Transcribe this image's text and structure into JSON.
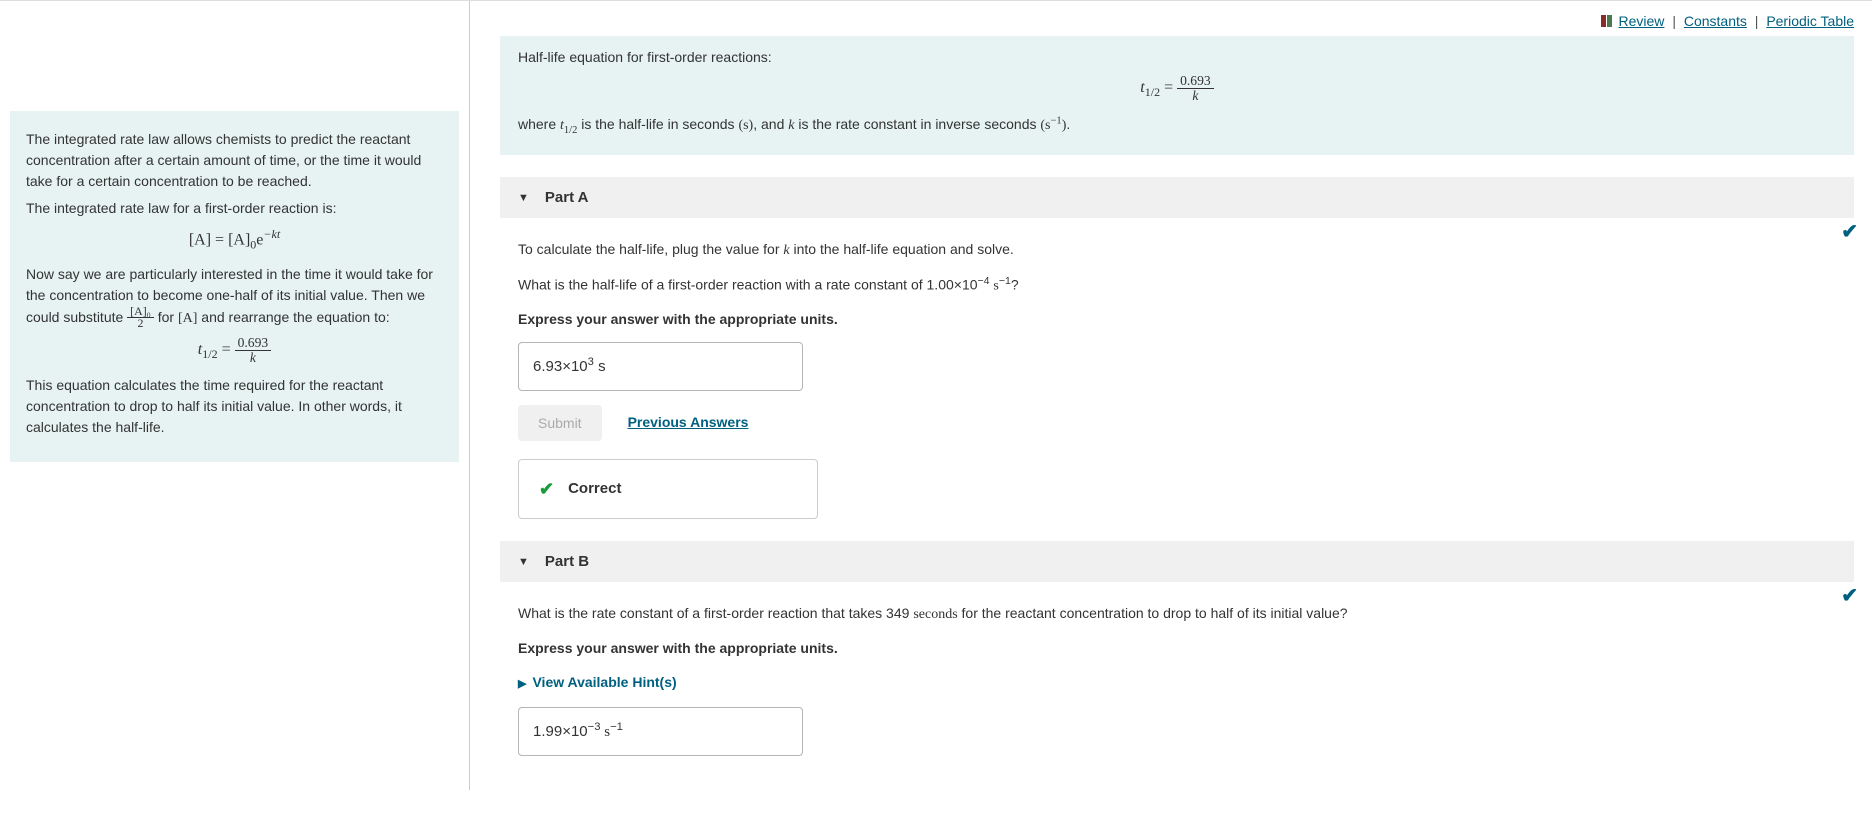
{
  "topLinks": {
    "review": "Review",
    "constants": "Constants",
    "periodic": "Periodic Table",
    "sep": "|"
  },
  "intro": {
    "p1": "The integrated rate law allows chemists to predict the reactant concentration after a certain amount of time, or the time it would take for a certain concentration to be reached.",
    "p2": "The integrated rate law for a first-order reaction is:",
    "eq1_lhs": "[A] = [A]",
    "eq1_sub": "0",
    "eq1_e": "e",
    "eq1_exp": "−kt",
    "p3a": "Now say we are particularly interested in the time it would take for the concentration to become one-half of its initial value. Then we could substitute ",
    "frac1_num": "[A]₀",
    "frac1_den": "2",
    "p3b": " for ",
    "p3c": "[A]",
    "p3d": " and rearrange the equation to:",
    "eq2_lhs": "t",
    "eq2_sub": "1/2",
    "eq2_eq": " = ",
    "eq2_num": "0.693",
    "eq2_den": "k",
    "p4": "This equation calculates the time required for the reactant concentration to drop to half its initial value. In other words, it calculates the half-life."
  },
  "infoBox": {
    "line1": "Half-life equation for first-order reactions:",
    "eq_lhs": "t",
    "eq_sub": "1/2",
    "eq_eq": " = ",
    "eq_num": "0.693",
    "eq_den": "k",
    "line2a": "where ",
    "line2b": "t",
    "line2b_sub": "1/2",
    "line2c": " is the half-life in seconds ",
    "line2d": "(s)",
    "line2e": ", and ",
    "line2f": "k",
    "line2g": " is the rate constant in inverse seconds ",
    "line2h": "(s",
    "line2h_sup": "−1",
    "line2i": ")",
    "line2j": "."
  },
  "partA": {
    "title": "Part A",
    "p1a": "To calculate the half-life, plug the value for ",
    "p1b": "k",
    "p1c": " into the half-life equation and solve.",
    "p2a": "What is the half-life of a first-order reaction with a rate constant of 1.00×10",
    "p2a_sup": "−4",
    "p2b": " s",
    "p2b_sup": "−1",
    "p2c": "?",
    "p3": "Express your answer with the appropriate units.",
    "answer_pre": "6.93×10",
    "answer_sup": "3",
    "answer_post": " s",
    "submit": "Submit",
    "prev": "Previous Answers",
    "correct": "Correct"
  },
  "partB": {
    "title": "Part B",
    "p1a": "What is the rate constant of a first-order reaction that takes 349 ",
    "p1b": "seconds",
    "p1c": " for the reactant concentration to drop to half of its initial value?",
    "p2": "Express your answer with the appropriate units.",
    "hints": "View Available Hint(s)",
    "answer_pre": "1.99×10",
    "answer_sup": "−3",
    "answer_mid": " s",
    "answer_sup2": "−1"
  }
}
